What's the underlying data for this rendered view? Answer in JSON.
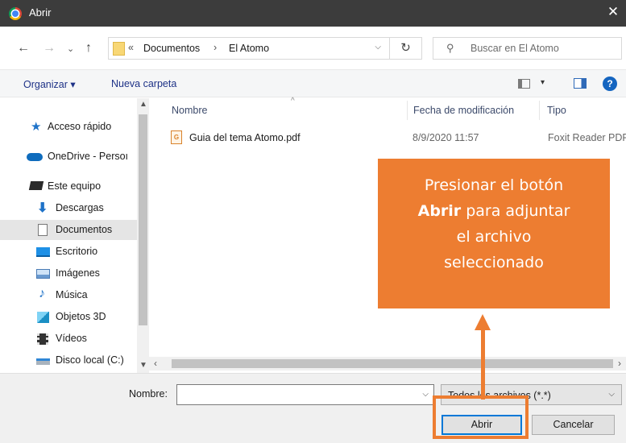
{
  "window": {
    "title": "Abrir",
    "close_glyph": "✕"
  },
  "navigation": {
    "back": "←",
    "forward": "→",
    "recent": "⌄",
    "up": "↑",
    "breadcrumb_prefix": "«",
    "breadcrumb": [
      "Documentos",
      "El Atomo"
    ],
    "breadcrumb_sep": "›",
    "refresh": "↻"
  },
  "search": {
    "placeholder": "Buscar en El Atomo",
    "icon": "search-icon"
  },
  "toolbar": {
    "organize": "Organizar ▾",
    "new_folder": "Nueva carpeta",
    "view_dd": "▾",
    "help": "?"
  },
  "sidebar": {
    "items": [
      {
        "label": "Acceso rápido",
        "icon": "star-icon"
      },
      {
        "label": "OneDrive - Persoı",
        "icon": "cloud-icon"
      },
      {
        "label": "Este equipo",
        "icon": "computer-icon"
      },
      {
        "label": "Descargas",
        "icon": "download-icon"
      },
      {
        "label": "Documentos",
        "icon": "document-icon",
        "selected": true
      },
      {
        "label": "Escritorio",
        "icon": "desktop-icon"
      },
      {
        "label": "Imágenes",
        "icon": "images-icon"
      },
      {
        "label": "Música",
        "icon": "music-icon"
      },
      {
        "label": "Objetos 3D",
        "icon": "cube-icon"
      },
      {
        "label": "Vídeos",
        "icon": "video-icon"
      },
      {
        "label": "Disco local (C:)",
        "icon": "drive-icon"
      }
    ]
  },
  "filelist": {
    "columns": [
      "Nombre",
      "Fecha de modificación",
      "Tipo"
    ],
    "files": [
      {
        "name": "Guia del tema Atomo.pdf",
        "date": "8/9/2020 11:57",
        "type": "Foxit Reader PDF",
        "icon": "pdf-icon"
      }
    ]
  },
  "footer": {
    "name_label": "Nombre:",
    "name_value": "",
    "filter": "Todos los archivos (*.*)",
    "open_button": "Abrir",
    "cancel_button": "Cancelar"
  },
  "annotation": {
    "line1": "Presionar el botón",
    "line2_bold": "Abrir",
    "line2_rest": " para adjuntar",
    "line3": "el archivo",
    "line4": "seleccionado",
    "color": "#ed7d31"
  }
}
